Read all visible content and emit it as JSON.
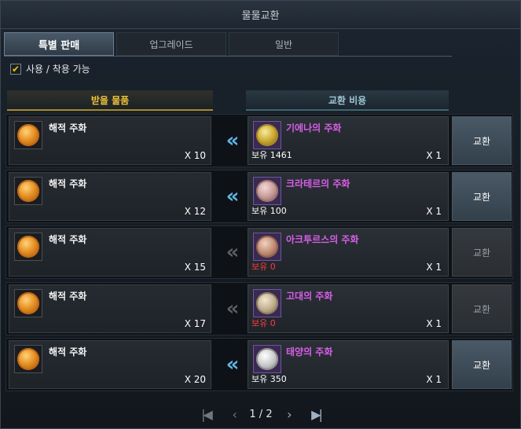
{
  "window": {
    "title": "물물교환"
  },
  "tabs": [
    {
      "label": "특별 판매",
      "active": true
    },
    {
      "label": "업그레이드",
      "active": false
    },
    {
      "label": "일반",
      "active": false
    }
  ],
  "filter": {
    "label": "사용 / 착용 가능",
    "checked": true
  },
  "headers": {
    "receive": "받을 물품",
    "cost": "교환 비용"
  },
  "rows": [
    {
      "receive": {
        "name": "해적 주화",
        "qty": "X 10"
      },
      "cost": {
        "name": "기에나의 주화",
        "owned": "보유 1461",
        "qty": "X 1",
        "coin": "gold"
      },
      "button": "교환",
      "enabled": true
    },
    {
      "receive": {
        "name": "해적 주화",
        "qty": "X 12"
      },
      "cost": {
        "name": "크라테르의 주화",
        "owned": "보유 100",
        "qty": "X 1",
        "coin": "rose"
      },
      "button": "교환",
      "enabled": true
    },
    {
      "receive": {
        "name": "해적 주화",
        "qty": "X 15"
      },
      "cost": {
        "name": "아크투르스의 주화",
        "owned": "보유 0",
        "qty": "X 1",
        "coin": "copper"
      },
      "button": "교환",
      "enabled": false
    },
    {
      "receive": {
        "name": "해적 주화",
        "qty": "X 17"
      },
      "cost": {
        "name": "고대의 주화",
        "owned": "보유 0",
        "qty": "X 1",
        "coin": "bronze"
      },
      "button": "교환",
      "enabled": false
    },
    {
      "receive": {
        "name": "해적 주화",
        "qty": "X 20"
      },
      "cost": {
        "name": "태양의 주화",
        "owned": "보유 350",
        "qty": "X 1",
        "coin": "silver"
      },
      "button": "교환",
      "enabled": true
    }
  ],
  "pagination": {
    "text": "1 / 2"
  },
  "colors": {
    "accent_gold": "#f0c43a",
    "cost_name": "#d85ee8",
    "owned_zero": "#ff3b3b",
    "arrow_active": "#5fb6e8"
  }
}
